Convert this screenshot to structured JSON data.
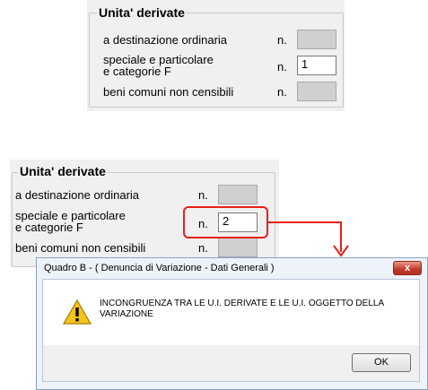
{
  "top_panel": {
    "group_title": "Unita' derivate",
    "rows": [
      {
        "label": "a destinazione ordinaria",
        "n": "n.",
        "value": ""
      },
      {
        "label_line1": "speciale e particolare",
        "label_line2": "e categorie F",
        "n": "n.",
        "value": "1"
      },
      {
        "label": "beni comuni non censibili",
        "n": "n.",
        "value": ""
      }
    ]
  },
  "bottom_panel": {
    "group_title": "Unita' derivate",
    "rows": [
      {
        "label": "a destinazione ordinaria",
        "n": "n.",
        "value": ""
      },
      {
        "label_line1": "speciale e particolare",
        "label_line2": "e categorie F",
        "n": "n.",
        "value": "2"
      },
      {
        "label": "beni comuni non censibili",
        "n": "n.",
        "value": ""
      }
    ]
  },
  "dialog": {
    "title": "Quadro B - ( Denuncia di Variazione - Dati Generali )",
    "close_label": "x",
    "message": "INCONGRUENZA TRA LE U.I. DERIVATE E LE U.I. OGGETTO DELLA VARIAZIONE",
    "ok_label": "OK",
    "icon": "warning-icon"
  },
  "colors": {
    "highlight": "#e8201c",
    "panel_bg": "#f0f0f0",
    "disabled_field": "#d0d0d0"
  }
}
